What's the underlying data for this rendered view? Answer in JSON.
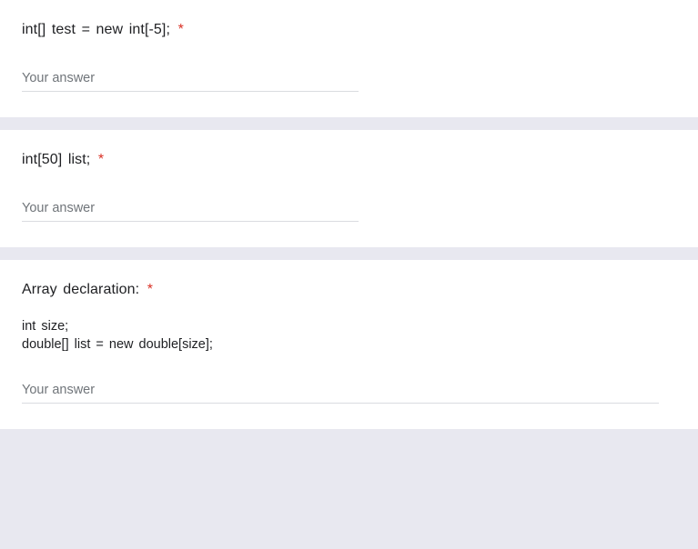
{
  "questions": [
    {
      "prompt": "int[] test = new int[-5];",
      "required_marker": "*",
      "placeholder": "Your answer",
      "input_class": "answer-input"
    },
    {
      "prompt": "int[50] list;",
      "required_marker": "*",
      "placeholder": "Your answer",
      "input_class": "answer-input"
    },
    {
      "prompt": "Array declaration:",
      "required_marker": "*",
      "code_line1": "int size;",
      "code_line2": "double[] list = new double[size];",
      "placeholder": "Your answer",
      "input_class": "answer-input wide"
    }
  ]
}
